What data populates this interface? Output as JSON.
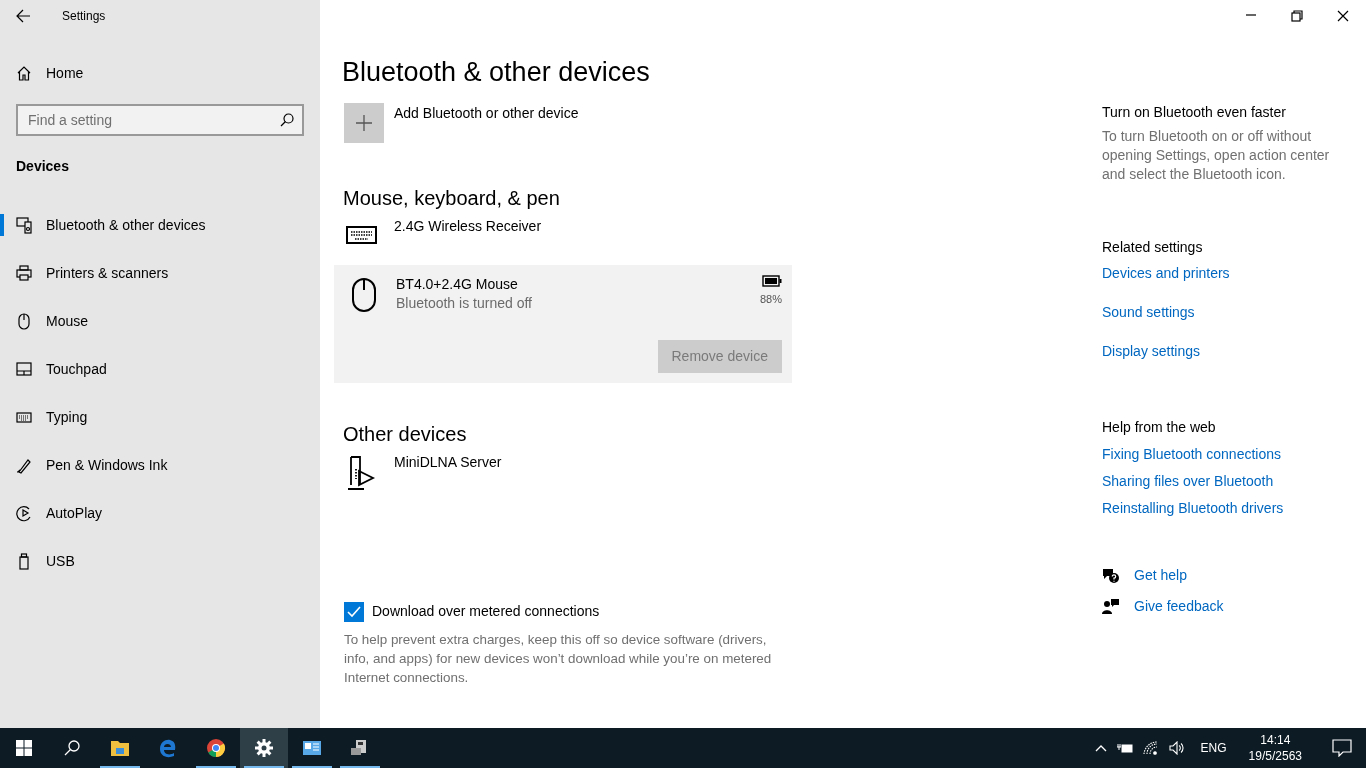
{
  "window": {
    "title": "Settings"
  },
  "sidebar": {
    "home": "Home",
    "search": {
      "placeholder": "Find a setting"
    },
    "section": "Devices",
    "items": [
      {
        "label": "Bluetooth & other devices",
        "selected": true
      },
      {
        "label": "Printers & scanners",
        "selected": false
      },
      {
        "label": "Mouse",
        "selected": false
      },
      {
        "label": "Touchpad",
        "selected": false
      },
      {
        "label": "Typing",
        "selected": false
      },
      {
        "label": "Pen & Windows Ink",
        "selected": false
      },
      {
        "label": "AutoPlay",
        "selected": false
      },
      {
        "label": "USB",
        "selected": false
      }
    ]
  },
  "page": {
    "title": "Bluetooth & other devices",
    "add_device": "Add Bluetooth or other device",
    "groups": [
      {
        "heading": "Mouse, keyboard, & pen",
        "devices": [
          {
            "kind": "keyboard",
            "name": "2.4G Wireless Receiver",
            "expanded": false
          },
          {
            "kind": "mouse",
            "name": "BT4.0+2.4G Mouse",
            "status": "Bluetooth is turned off",
            "battery": "88%",
            "expanded": true,
            "action": {
              "label": "Remove device",
              "disabled": true
            }
          }
        ]
      },
      {
        "heading": "Other devices",
        "devices": [
          {
            "kind": "media",
            "name": "MiniDLNA Server",
            "expanded": false
          }
        ]
      }
    ],
    "metered": {
      "label": "Download over metered connections",
      "checked": true,
      "description": "To help prevent extra charges, keep this off so device software (drivers, info, and apps) for new devices won’t download while you’re on metered Internet connections."
    }
  },
  "aside": {
    "tip": {
      "heading": "Turn on Bluetooth even faster",
      "text": "To turn Bluetooth on or off without opening Settings, open action center and select the Bluetooth icon."
    },
    "related": {
      "heading": "Related settings",
      "links": [
        "Devices and printers",
        "Sound settings",
        "Display settings"
      ]
    },
    "help": {
      "heading": "Help from the web",
      "links": [
        "Fixing Bluetooth connections",
        "Sharing files over Bluetooth",
        "Reinstalling Bluetooth drivers"
      ]
    },
    "support": [
      {
        "kind": "help",
        "label": "Get help"
      },
      {
        "kind": "feedback",
        "label": "Give feedback"
      }
    ]
  },
  "taskbar": {
    "apps": [
      {
        "kind": "files",
        "running": true,
        "selected": false
      },
      {
        "kind": "edge",
        "running": false,
        "selected": false
      },
      {
        "kind": "chrome",
        "running": true,
        "selected": false
      },
      {
        "kind": "settings",
        "running": true,
        "selected": true
      },
      {
        "kind": "panel",
        "running": true,
        "selected": false
      },
      {
        "kind": "computer",
        "running": true,
        "selected": false
      }
    ],
    "language": "ENG",
    "time": "14:14",
    "date": "19/5/2563"
  }
}
